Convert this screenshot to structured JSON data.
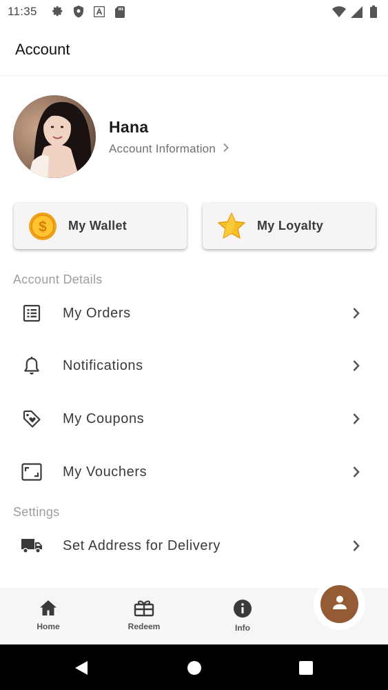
{
  "status_bar": {
    "time": "11:35",
    "left_icons": [
      "gear-icon",
      "shield-icon",
      "font-a-icon",
      "sd-card-icon"
    ],
    "right_icons": [
      "wifi-icon",
      "cell-signal-icon",
      "battery-icon"
    ]
  },
  "app_bar": {
    "title": "Account"
  },
  "profile": {
    "name": "Hana",
    "account_link": "Account Information",
    "avatar": "user-photo"
  },
  "cards": [
    {
      "label": "My Wallet",
      "icon": "coin-icon"
    },
    {
      "label": "My Loyalty",
      "icon": "star-icon"
    }
  ],
  "account_details": {
    "title": "Account Details",
    "items": [
      {
        "label": "My Orders",
        "icon": "list-icon"
      },
      {
        "label": "Notifications",
        "icon": "bell-icon"
      },
      {
        "label": "My Coupons",
        "icon": "tag-icon"
      },
      {
        "label": "My Vouchers",
        "icon": "voucher-icon"
      }
    ]
  },
  "settings": {
    "title": "Settings",
    "items": [
      {
        "label": "Set Address for Delivery",
        "icon": "truck-icon"
      }
    ]
  },
  "bottom_nav": {
    "items": [
      {
        "label": "Home",
        "icon": "home-icon"
      },
      {
        "label": "Redeem",
        "icon": "gift-icon"
      },
      {
        "label": "Info",
        "icon": "info-icon"
      }
    ],
    "active_icon": "person-icon"
  },
  "colors": {
    "accent": "#955b35",
    "section_title": "#9e9e9e",
    "text": "#3a3a3a",
    "card_bg": "#f6f4f4"
  }
}
